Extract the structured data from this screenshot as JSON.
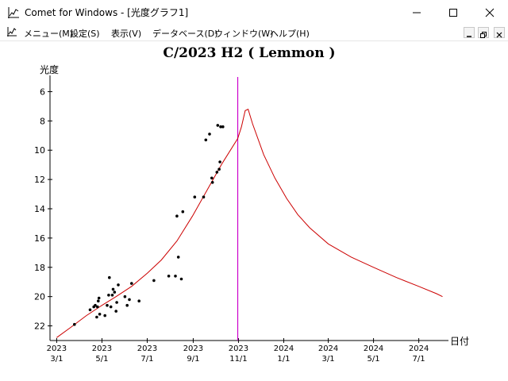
{
  "window": {
    "title": "Comet for Windows - [光度グラフ1]",
    "icon": "chart-icon",
    "controls": [
      "minimize-icon",
      "maximize-icon",
      "close-icon"
    ]
  },
  "menu": {
    "items": [
      "メニュー(M)",
      "設定(S)",
      "表示(V)",
      "データベース(D)",
      "ウィンドウ(W)",
      "ヘルプ(H)"
    ],
    "mdi_controls": [
      "minimize-icon",
      "restore-icon",
      "close-icon"
    ]
  },
  "chart_data": {
    "type": "scatter",
    "title": "C/2023 H2 ( Lemmon )",
    "xlabel": "日付",
    "ylabel": "光度",
    "x_ticks": [
      {
        "year": "2023",
        "date": "3/1"
      },
      {
        "year": "2023",
        "date": "5/1"
      },
      {
        "year": "2023",
        "date": "7/1"
      },
      {
        "year": "2023",
        "date": "9/1"
      },
      {
        "year": "2023",
        "date": "11/1"
      },
      {
        "year": "2024",
        "date": "1/1"
      },
      {
        "year": "2024",
        "date": "3/1"
      },
      {
        "year": "2024",
        "date": "5/1"
      },
      {
        "year": "2024",
        "date": "7/1"
      }
    ],
    "x_tick_dates": [
      "2023-03-01",
      "2023-05-01",
      "2023-07-01",
      "2023-09-01",
      "2023-11-01",
      "2024-01-01",
      "2024-03-01",
      "2024-05-01",
      "2024-07-01"
    ],
    "xlim": [
      "2023-02-20",
      "2024-08-10"
    ],
    "y_ticks": [
      6,
      8,
      10,
      12,
      14,
      16,
      18,
      20,
      22
    ],
    "ylim": [
      5,
      23
    ],
    "y_inverted": true,
    "current_date": "2023-10-31",
    "colors": {
      "curve": "#cc0000",
      "marker": "#cc00cc",
      "points": "#000000",
      "axis": "#000000"
    },
    "series": [
      {
        "kind": "curve",
        "points": [
          [
            "2023-03-01",
            22.8
          ],
          [
            "2023-03-20",
            22.1
          ],
          [
            "2023-04-10",
            21.3
          ],
          [
            "2023-05-01",
            20.6
          ],
          [
            "2023-05-20",
            20.0
          ],
          [
            "2023-06-10",
            19.3
          ],
          [
            "2023-07-01",
            18.4
          ],
          [
            "2023-07-20",
            17.5
          ],
          [
            "2023-08-10",
            16.2
          ],
          [
            "2023-08-31",
            14.5
          ],
          [
            "2023-09-20",
            12.7
          ],
          [
            "2023-10-10",
            10.9
          ],
          [
            "2023-10-31",
            9.2
          ],
          [
            "2023-11-05",
            8.4
          ],
          [
            "2023-11-10",
            7.3
          ],
          [
            "2023-11-14",
            7.2
          ],
          [
            "2023-11-20",
            8.2
          ],
          [
            "2023-12-05",
            10.3
          ],
          [
            "2023-12-20",
            11.9
          ],
          [
            "2024-01-05",
            13.3
          ],
          [
            "2024-01-20",
            14.4
          ],
          [
            "2024-02-05",
            15.3
          ],
          [
            "2024-03-01",
            16.4
          ],
          [
            "2024-04-01",
            17.3
          ],
          [
            "2024-05-01",
            18.0
          ],
          [
            "2024-06-01",
            18.7
          ],
          [
            "2024-07-01",
            19.3
          ],
          [
            "2024-07-25",
            19.8
          ],
          [
            "2024-08-02",
            20.0
          ]
        ]
      },
      {
        "kind": "observations",
        "points": [
          [
            "2023-03-25",
            21.9
          ],
          [
            "2023-04-15",
            20.9
          ],
          [
            "2023-04-20",
            20.7
          ],
          [
            "2023-04-22",
            20.6
          ],
          [
            "2023-04-24",
            21.4
          ],
          [
            "2023-04-25",
            20.7
          ],
          [
            "2023-04-26",
            20.3
          ],
          [
            "2023-04-27",
            20.1
          ],
          [
            "2023-04-28",
            21.2
          ],
          [
            "2023-05-05",
            21.3
          ],
          [
            "2023-05-08",
            20.6
          ],
          [
            "2023-05-10",
            19.9
          ],
          [
            "2023-05-11",
            18.7
          ],
          [
            "2023-05-13",
            20.7
          ],
          [
            "2023-05-15",
            19.9
          ],
          [
            "2023-05-16",
            19.5
          ],
          [
            "2023-05-18",
            19.7
          ],
          [
            "2023-05-20",
            21.0
          ],
          [
            "2023-05-21",
            20.4
          ],
          [
            "2023-05-23",
            19.2
          ],
          [
            "2023-06-01",
            20.0
          ],
          [
            "2023-06-04",
            20.6
          ],
          [
            "2023-06-07",
            20.2
          ],
          [
            "2023-06-10",
            19.1
          ],
          [
            "2023-06-20",
            20.3
          ],
          [
            "2023-07-10",
            18.9
          ],
          [
            "2023-07-30",
            18.6
          ],
          [
            "2023-08-08",
            18.6
          ],
          [
            "2023-08-10",
            14.5
          ],
          [
            "2023-08-12",
            17.3
          ],
          [
            "2023-08-16",
            18.8
          ],
          [
            "2023-08-18",
            14.2
          ],
          [
            "2023-09-03",
            13.2
          ],
          [
            "2023-09-15",
            13.2
          ],
          [
            "2023-09-18",
            9.3
          ],
          [
            "2023-09-23",
            8.9
          ],
          [
            "2023-09-26",
            11.9
          ],
          [
            "2023-09-27",
            12.2
          ],
          [
            "2023-10-03",
            11.5
          ],
          [
            "2023-10-04",
            8.3
          ],
          [
            "2023-10-06",
            11.3
          ],
          [
            "2023-10-07",
            10.8
          ],
          [
            "2023-10-08",
            8.4
          ],
          [
            "2023-10-11",
            8.4
          ]
        ]
      }
    ]
  }
}
